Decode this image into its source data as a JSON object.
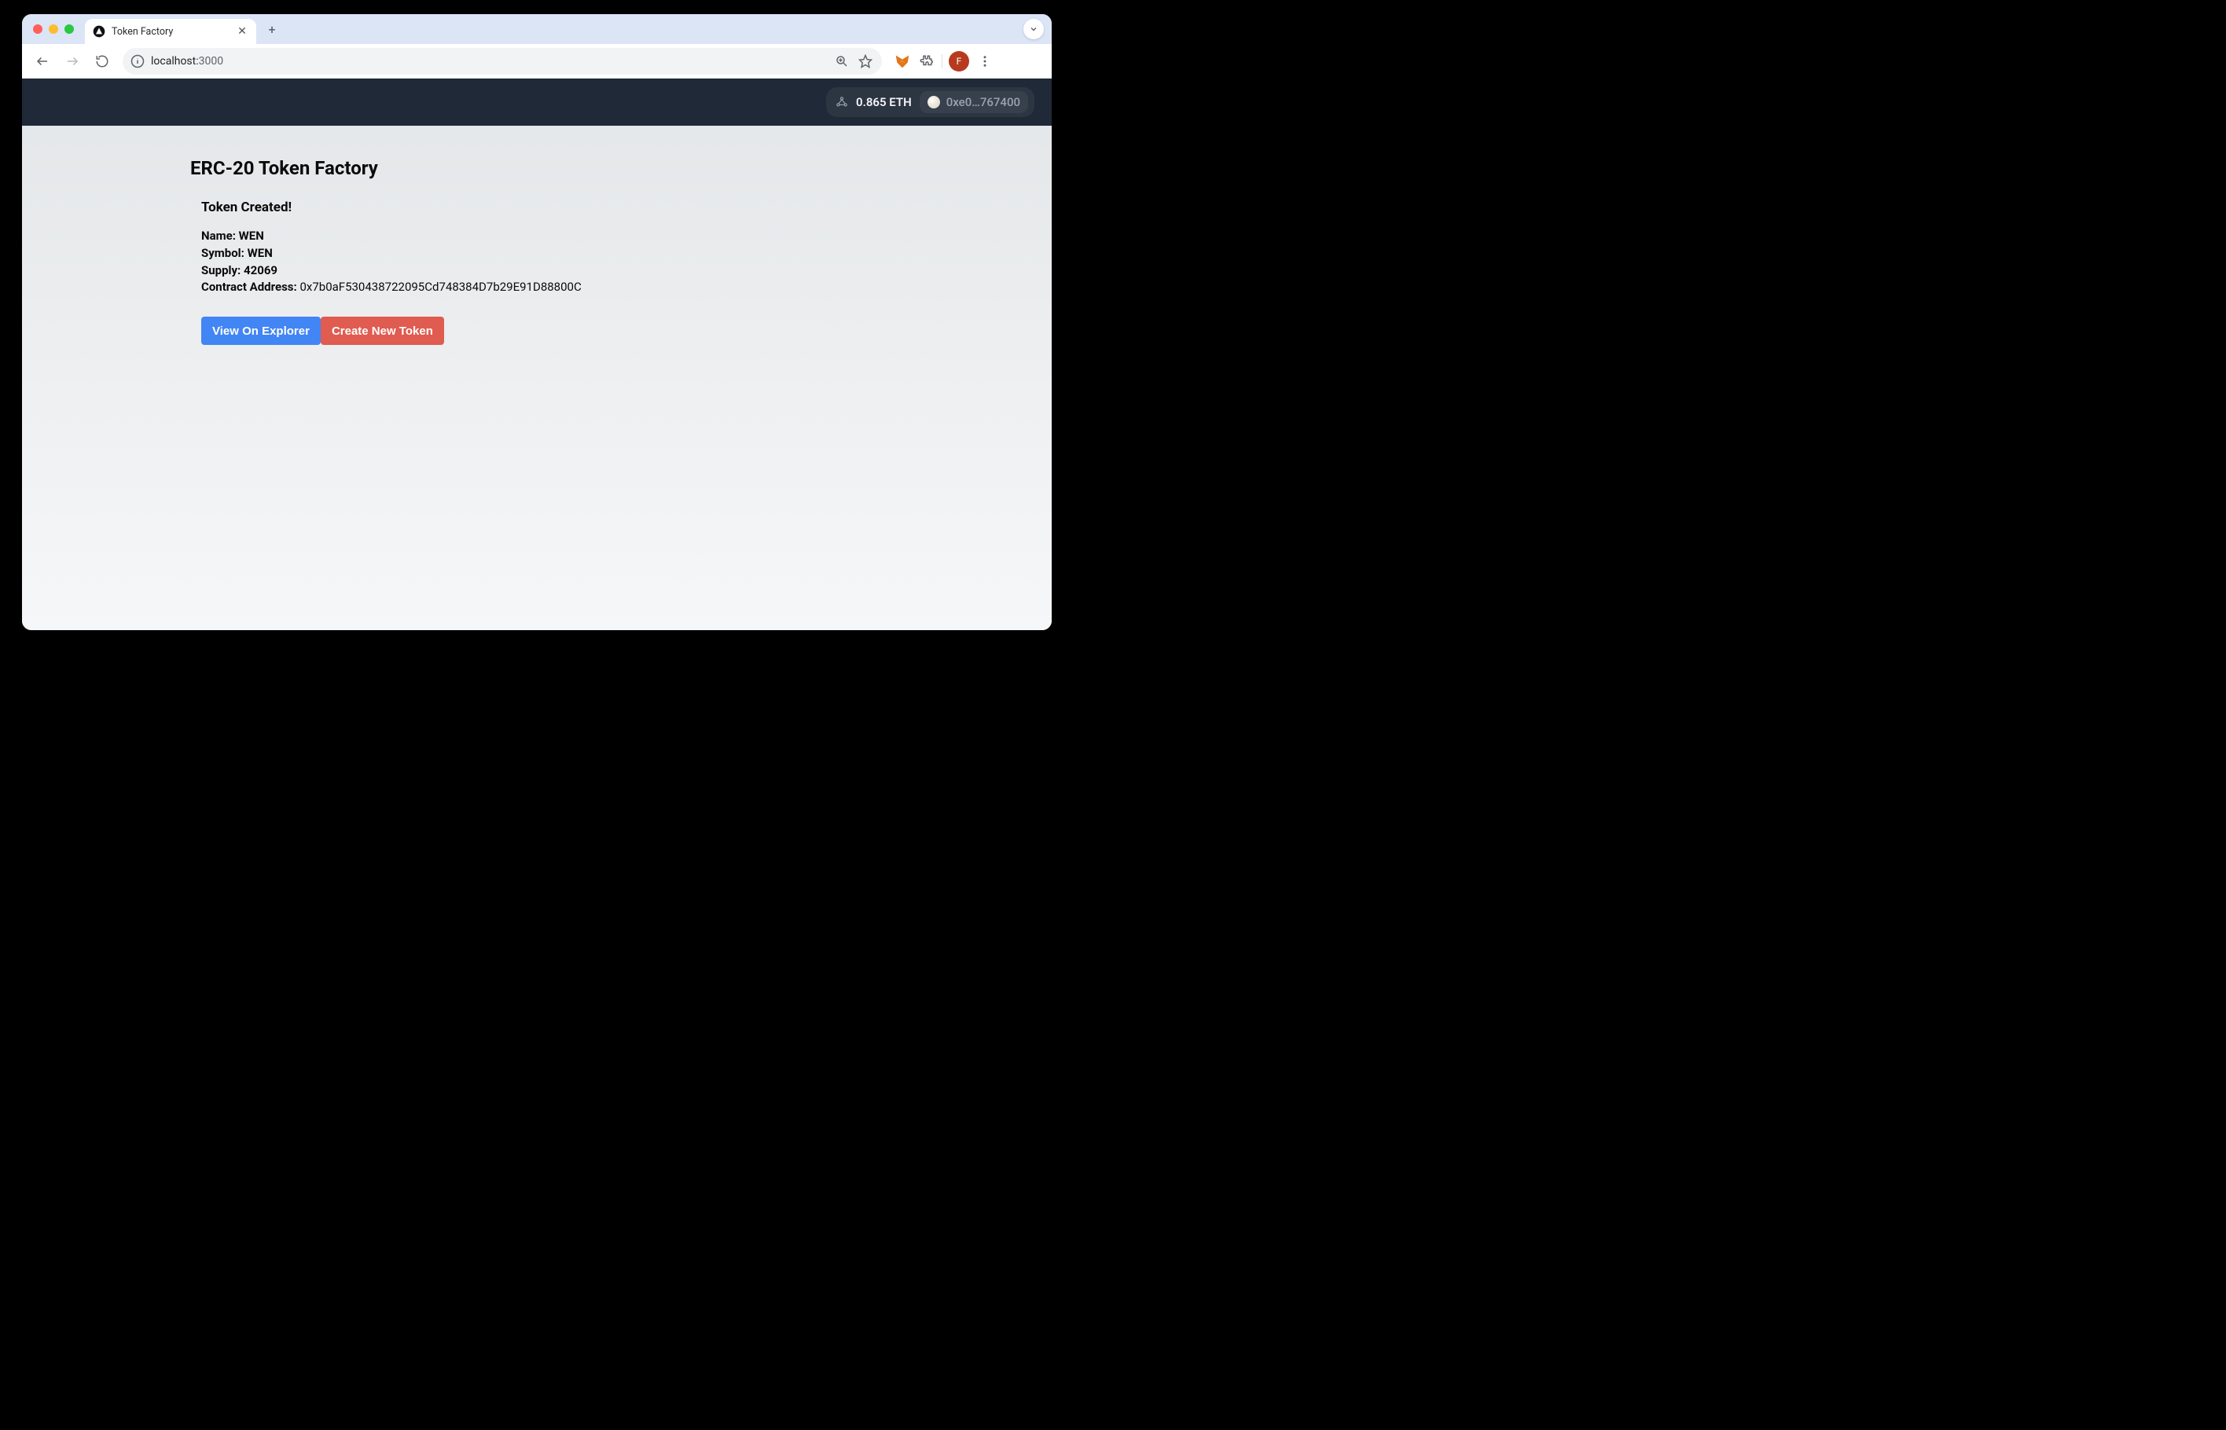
{
  "browser": {
    "tab_title": "Token Factory",
    "url_host": "localhost:",
    "url_path": "3000",
    "avatar_letter": "F"
  },
  "header": {
    "balance": "0.865 ETH",
    "address_short": "0xe0…767400"
  },
  "main": {
    "title": "ERC-20 Token Factory",
    "created_title": "Token Created!",
    "labels": {
      "name": "Name:",
      "symbol": "Symbol:",
      "supply": "Supply:",
      "contract": "Contract Address:"
    },
    "token": {
      "name": "WEN",
      "symbol": "WEN",
      "supply": "42069",
      "contract_address": "0x7b0aF530438722095Cd748384D7b29E91D88800C"
    },
    "buttons": {
      "view_explorer": "View On Explorer",
      "create_new": "Create New Token"
    }
  }
}
